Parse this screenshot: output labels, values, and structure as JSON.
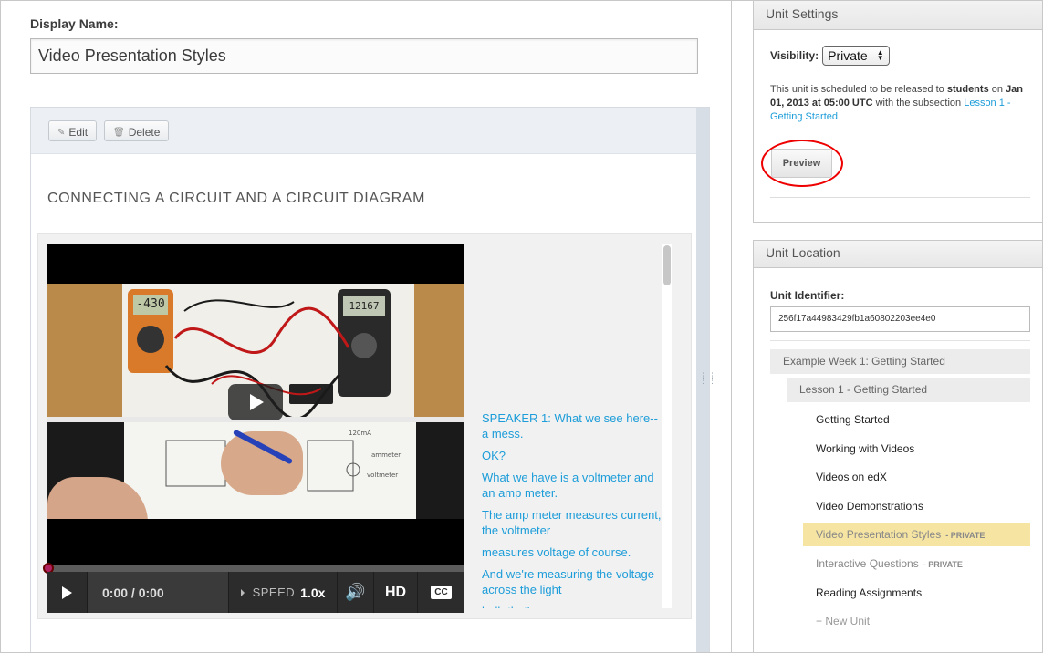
{
  "editor": {
    "display_name_label": "Display Name:",
    "display_name_value": "Video Presentation Styles"
  },
  "component": {
    "edit_label": "Edit",
    "delete_label": "Delete",
    "title": "CONNECTING A CIRCUIT AND A CIRCUIT DIAGRAM",
    "video": {
      "time": "0:00 / 0:00",
      "speed_label": "SPEED",
      "speed_value": "1.0x",
      "hd_label": "HD",
      "cc_label": "CC",
      "meter_left_reading": "-430",
      "meter_right_reading": "12167",
      "progress": 0
    },
    "transcript": [
      "SPEAKER 1: What we see here-- a mess.",
      "OK?",
      "What we have is a voltmeter and an amp meter.",
      "The amp meter measures current, the voltmeter",
      "measures voltage of course.",
      "And we're measuring the voltage across the light",
      "bulb that's"
    ]
  },
  "unit_settings": {
    "title": "Unit Settings",
    "visibility_label": "Visibility:",
    "visibility_value": "Private",
    "schedule_prefix": "This unit is scheduled to be released to",
    "schedule_audience": "students",
    "schedule_on": "on",
    "schedule_datetime": "Jan 01, 2013 at 05:00 UTC",
    "schedule_mid": "with the subsection",
    "schedule_link": "Lesson 1 - Getting Started",
    "preview_label": "Preview"
  },
  "unit_location": {
    "title": "Unit Location",
    "identifier_label": "Unit Identifier:",
    "identifier_value": "256f17a44983429fb1a60802203ee4e0",
    "week": "Example Week 1: Getting Started",
    "lesson": "Lesson 1 - Getting Started",
    "units": [
      {
        "label": "Getting Started",
        "private": ""
      },
      {
        "label": "Working with Videos",
        "private": ""
      },
      {
        "label": "Videos on edX",
        "private": ""
      },
      {
        "label": "Video Demonstrations",
        "private": ""
      },
      {
        "label": "Video Presentation Styles",
        "private": "- PRIVATE"
      },
      {
        "label": "Interactive Questions",
        "private": "- PRIVATE"
      },
      {
        "label": "Reading Assignments",
        "private": ""
      }
    ],
    "new_unit_label": "+ New Unit"
  },
  "colors": {
    "link": "#1d9dd9",
    "active_unit_bg": "#f6e4a3",
    "highlight_ring": "#ee0000",
    "progress_knob": "#b0225f"
  }
}
